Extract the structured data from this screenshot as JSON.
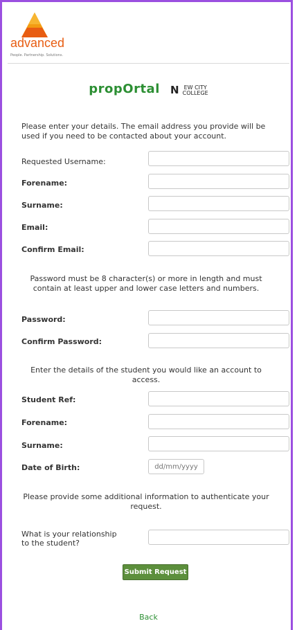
{
  "header": {
    "logo_word": "advanced",
    "logo_tagline": "People. Partnership. Solutions."
  },
  "brand": {
    "proportal": "propOrtal",
    "ncc_top": "EW CITY",
    "ncc_bottom": "COLLEGE"
  },
  "intro": "Please enter your details. The email address you provide will be used if you need to be contacted about your account.",
  "fields": {
    "username_label": "Requested Username:",
    "forename_label": "Forename:",
    "surname_label": "Surname:",
    "email_label": "Email:",
    "confirm_email_label": "Confirm Email:",
    "password_label": "Password:",
    "confirm_password_label": "Confirm Password:",
    "student_ref_label": "Student Ref:",
    "student_forename_label": "Forename:",
    "student_surname_label": "Surname:",
    "dob_label": "Date of Birth:",
    "dob_placeholder": "dd/mm/yyyy",
    "relationship_label": "What is your relationship to the student?"
  },
  "password_note": "Password must be 8 character(s) or more in length and must contain at least upper and lower case letters and numbers.",
  "student_note": "Enter the details of the student you would like an account to access.",
  "auth_note": "Please provide some additional information to authenticate your request.",
  "actions": {
    "submit": "Submit Request",
    "back": "Back"
  },
  "colors": {
    "frame": "#9b4fe0",
    "brand_orange": "#e85d12",
    "proportal_green": "#2c8f33",
    "button_green": "#5c8f3c"
  }
}
